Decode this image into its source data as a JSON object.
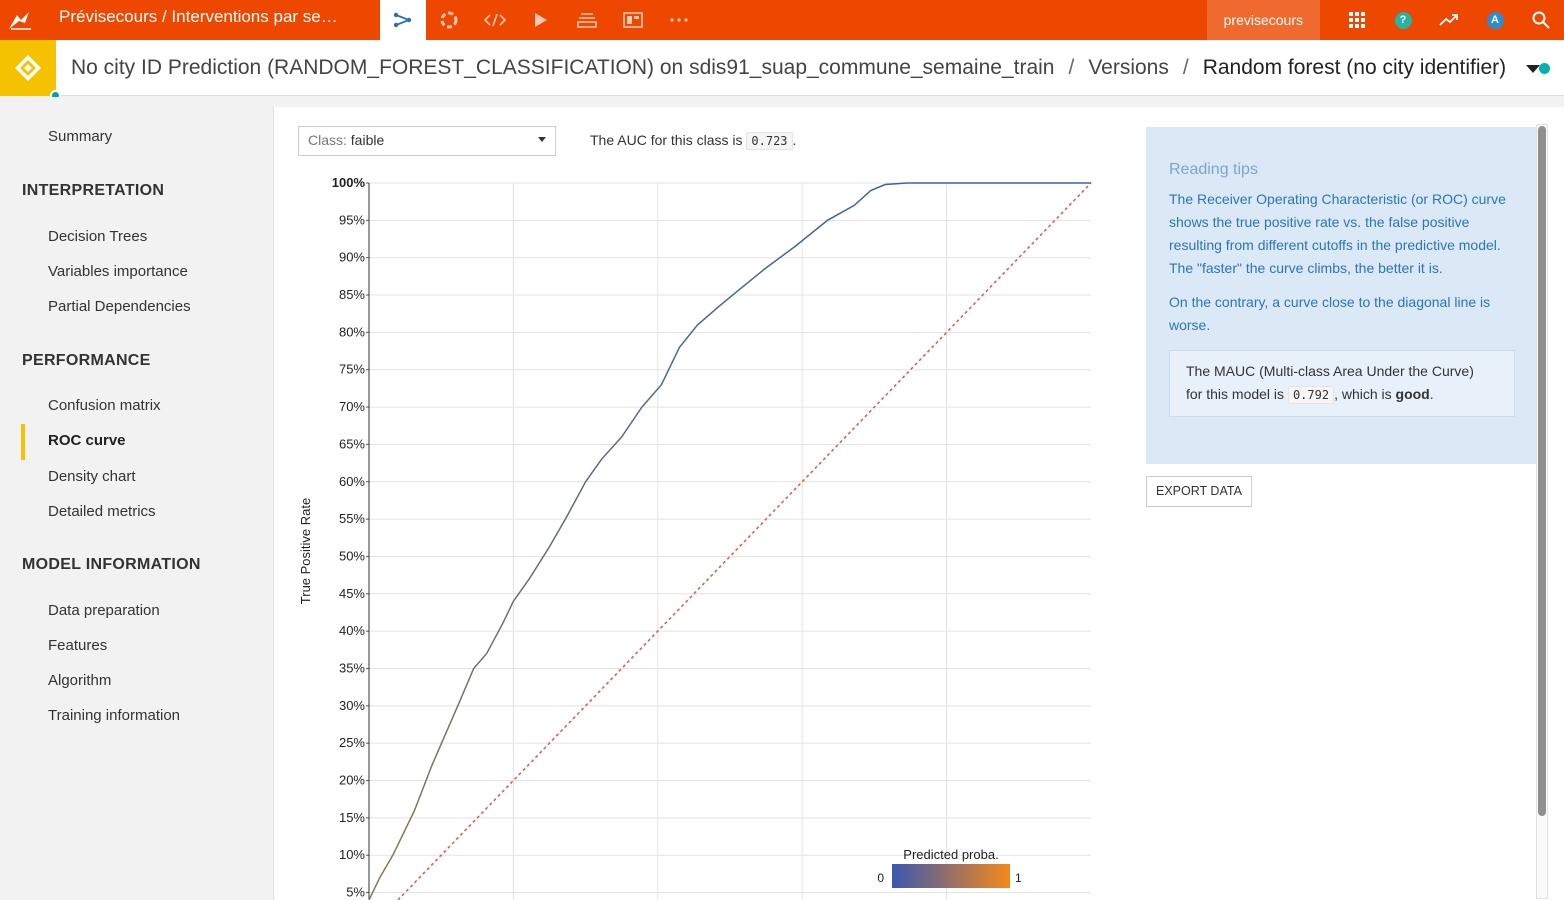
{
  "topbar": {
    "breadcrumb": "Prévisecours / Interventions par se…",
    "icons": [
      "flow-icon",
      "lifebuoy-icon",
      "code-icon",
      "play-icon",
      "stack-icon",
      "dashboard-icon",
      "more-icon"
    ],
    "user_label": "previsecours",
    "right_icons": [
      "grid-icon",
      "help-icon",
      "activity-icon",
      "avatar-icon",
      "search-icon"
    ],
    "avatar_letter": "A",
    "help_glyph": "?",
    "colors": {
      "bar": "#ee4700",
      "user": "#f06a30"
    }
  },
  "header": {
    "title": "No city ID Prediction (RANDOM_FOREST_CLASSIFICATION) on sdis91_suap_commune_semaine_train",
    "sep1": "/",
    "versions": "Versions",
    "sep2": "/",
    "current": "Random forest (no city identifier)",
    "badge_color": "#f5c200"
  },
  "sidebar": {
    "summary": "Summary",
    "interpretation_head": "INTERPRETATION",
    "decision_trees": "Decision Trees",
    "variables_importance": "Variables importance",
    "partial_dependencies": "Partial Dependencies",
    "performance_head": "PERFORMANCE",
    "confusion_matrix": "Confusion matrix",
    "roc_curve": "ROC curve",
    "density_chart": "Density chart",
    "detailed_metrics": "Detailed metrics",
    "model_info_head": "MODEL INFORMATION",
    "data_preparation": "Data preparation",
    "features": "Features",
    "algorithm": "Algorithm",
    "training_information": "Training information"
  },
  "main": {
    "class_label": "Class:",
    "class_value": "faible",
    "auc_prefix": "The AUC for this class is",
    "auc_value": "0.723",
    "auc_suffix": "."
  },
  "tips": {
    "title": "Reading tips",
    "p1": "The Receiver Operating Characteristic (or ROC) curve shows the true positive rate vs. the false positive resulting from different cutoffs in the predictive model. The \"faster\" the curve climbs, the better it is.",
    "p2": "On the contrary, a curve close to the diagonal line is worse.",
    "mauc_line1": "The MAUC (Multi-class Area Under the Curve)",
    "mauc_prefix": "for this model is",
    "mauc_value": "0.792",
    "mauc_mid": ", which is",
    "mauc_quality": "good",
    "mauc_suffix": ".",
    "export_label": "EXPORT DATA"
  },
  "chart_data": {
    "type": "line",
    "title": "",
    "xlabel": "",
    "ylabel": "True Positive Rate",
    "ylim": [
      0.04,
      1.0
    ],
    "xlim": [
      0,
      1
    ],
    "yticks": [
      "100%",
      "95%",
      "90%",
      "85%",
      "80%",
      "75%",
      "70%",
      "65%",
      "60%",
      "55%",
      "50%",
      "45%",
      "40%",
      "35%",
      "30%",
      "25%",
      "20%",
      "15%",
      "10%",
      "5%"
    ],
    "ytick_values": [
      1.0,
      0.95,
      0.9,
      0.85,
      0.8,
      0.75,
      0.7,
      0.65,
      0.6,
      0.55,
      0.5,
      0.45,
      0.4,
      0.35,
      0.3,
      0.25,
      0.2,
      0.15,
      0.1,
      0.05
    ],
    "xgrid": [
      0.2,
      0.4,
      0.6,
      0.8
    ],
    "grid": true,
    "series": [
      {
        "x": [
          0.0,
          0.015,
          0.033,
          0.048,
          0.063,
          0.075,
          0.087,
          0.105,
          0.123,
          0.145,
          0.163,
          0.185,
          0.2,
          0.222,
          0.248,
          0.272,
          0.3,
          0.322,
          0.35,
          0.378,
          0.405,
          0.43,
          0.455,
          0.485,
          0.51,
          0.548,
          0.59,
          0.635,
          0.672,
          0.695,
          0.715,
          0.745,
          0.8,
          1.0
        ],
        "y": [
          0.04,
          0.07,
          0.1,
          0.13,
          0.16,
          0.19,
          0.22,
          0.26,
          0.3,
          0.35,
          0.37,
          0.41,
          0.44,
          0.47,
          0.51,
          0.55,
          0.6,
          0.63,
          0.66,
          0.7,
          0.73,
          0.78,
          0.81,
          0.835,
          0.855,
          0.885,
          0.915,
          0.95,
          0.97,
          0.99,
          0.998,
          1.0,
          1.0,
          1.0
        ],
        "color_start": "#8a7a4a",
        "color_end": "#3a62ad"
      }
    ],
    "diagonal_color": "#e85a4f",
    "colorbar": {
      "label": "Predicted proba.",
      "min_label": "0",
      "max_label": "1",
      "color_from": "#3a58b0",
      "color_to": "#f5891a"
    }
  }
}
